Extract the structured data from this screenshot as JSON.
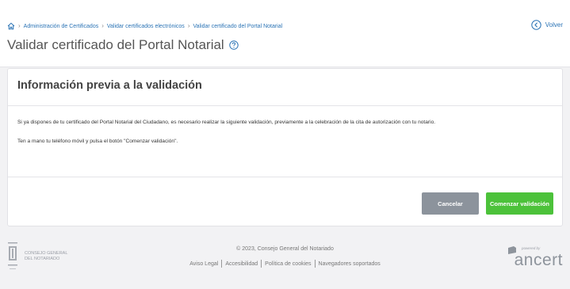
{
  "breadcrumb": {
    "home_icon": "home-icon",
    "items": [
      "Administración de Certificados",
      "Validar certificados electrónicos",
      "Validar certificado del Portal Notarial"
    ]
  },
  "header": {
    "title": "Validar certificado del Portal Notarial",
    "help_icon": "help-circle-icon",
    "back_label": "Volver",
    "back_icon": "chevron-left-circle-icon"
  },
  "card": {
    "title": "Información previa a la validación",
    "paragraphs": [
      "Si ya dispones de tu certificado del Portal Notarial del Ciudadano, es necesario realizar la siguiente validación, previamente a la celebración de la cita de autorización con tu notario.",
      "Ten a mano tu teléfono móvil y pulsa el botón \"Comenzar validación\"."
    ],
    "cancel_label": "Cancelar",
    "start_label": "Comenzar validación"
  },
  "footer": {
    "org_name": "Consejo General del Notariado",
    "copyright": "© 2023, Consejo General del Notariado",
    "links": [
      "Aviso Legal",
      "Accesibilidad",
      "Política de cookies",
      "Navegadores soportados"
    ],
    "powered_by": "powered by",
    "brand": "ancert"
  },
  "colors": {
    "link": "#2a73b5",
    "cancel_button": "#8c939c",
    "start_button": "#4cc23a",
    "background": "#f2f2f4"
  }
}
